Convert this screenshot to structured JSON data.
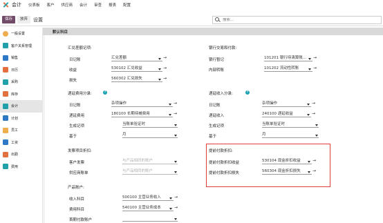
{
  "topbar": {
    "app_title": "会计",
    "menu": [
      "仪表板",
      "客户",
      "供应商",
      "会计",
      "审查",
      "报表",
      "配置"
    ]
  },
  "controlbar": {
    "save_label": "保存",
    "discard_label": "放弃",
    "breadcrumb": "设置",
    "search_placeholder": "搜索..."
  },
  "sidebar": {
    "items": [
      {
        "label": "一般设置",
        "color": "#f0ad4e"
      },
      {
        "label": "客户关系管理",
        "color": "#22a0a9"
      },
      {
        "label": "销售",
        "color": "#2f78c5"
      },
      {
        "label": "日历",
        "color": "#e46f3e"
      },
      {
        "label": "采购",
        "color": "#22a0a9"
      },
      {
        "label": "库存",
        "color": "#e46f3e"
      },
      {
        "label": "会计",
        "color": "#22a0a9"
      },
      {
        "label": "计划",
        "color": "#2f78c5"
      },
      {
        "label": "员工",
        "color": "#f0ad4e"
      },
      {
        "label": "工资",
        "color": "#2f78c5"
      },
      {
        "label": "出勤",
        "color": "#e46f3e"
      },
      {
        "label": "费用",
        "color": "#22a0a9"
      }
    ],
    "active_index": 6
  },
  "main": {
    "section_title": "默认科目",
    "fx": {
      "title": "汇兑差额记项:",
      "rows": [
        {
          "label": "日记账",
          "value": "汇兑差额"
        },
        {
          "label": "收益",
          "value": "530102 汇兑收益"
        },
        {
          "label": "损失",
          "value": "560302 汇兑损失"
        }
      ]
    },
    "bank": {
      "title": "银行交易和付款:",
      "rows": [
        {
          "label": "银行暂记",
          "value": "101201 银行待清算账..."
        },
        {
          "label": "内部转账",
          "value": "101202 流动性转账"
        }
      ]
    },
    "expense_accrual": {
      "title": "递延费用分录:",
      "rows": [
        {
          "label": "日记账",
          "value": "杂项操作"
        },
        {
          "label": "递延费用",
          "value": "180100 长期待摊费用"
        },
        {
          "label": "生成记项",
          "value": "当账单验证时"
        },
        {
          "label": "基于",
          "value": "月"
        }
      ]
    },
    "revenue_accrual": {
      "title": "递延收入分录:",
      "rows": [
        {
          "label": "日记账",
          "value": "杂项操作"
        },
        {
          "label": "递延收入",
          "value": "240100 递延收益"
        },
        {
          "label": "生成记项",
          "value": "当账单验证时"
        },
        {
          "label": "基于",
          "value": "月"
        }
      ]
    },
    "invoice_discount": {
      "title": "发票项目折扣:",
      "rows": [
        {
          "label": "客户发票",
          "value": "与产品相同的账户"
        },
        {
          "label": "供应商账单",
          "value": "与产品相同的账户"
        }
      ]
    },
    "early_payment": {
      "title": "提前付款折扣:",
      "rows": [
        {
          "label": "提前付款折扣收益",
          "value": "530104 现金折扣收益"
        },
        {
          "label": "提前付款折扣损失",
          "value": "560304 现金折扣损失"
        }
      ]
    },
    "product": {
      "title": "产品账户:",
      "rows": [
        {
          "label": "收入科目",
          "value": "500100 主营业务收入"
        },
        {
          "label": "费用科目",
          "value": "540100 主营业务成本"
        },
        {
          "label": "首期付款账户",
          "value": ""
        }
      ]
    }
  },
  "colors": {
    "accent": "#714b67",
    "highlight_box": "#e23b3b",
    "help": "#1aa1b3"
  },
  "icons": {
    "help": "?",
    "link": "→"
  }
}
